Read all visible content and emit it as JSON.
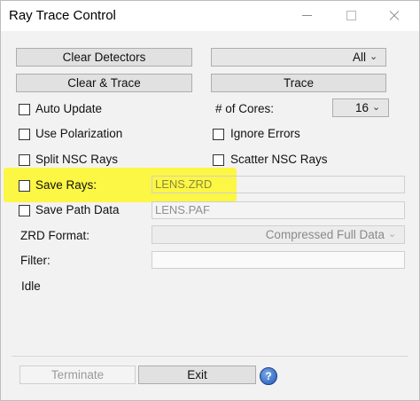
{
  "window": {
    "title": "Ray Trace Control"
  },
  "toolbar": {
    "clear_detectors": "Clear Detectors",
    "detector_select": "All",
    "clear_and_trace": "Clear & Trace",
    "trace": "Trace"
  },
  "options": {
    "auto_update": "Auto Update",
    "cores_label": "# of Cores:",
    "cores_value": "16",
    "use_polarization": "Use Polarization",
    "ignore_errors": "Ignore Errors",
    "split_nsc_rays": "Split NSC Rays",
    "scatter_nsc_rays": "Scatter NSC Rays",
    "save_rays": "Save Rays:",
    "save_rays_file": "LENS.ZRD",
    "save_path_data": "Save Path Data",
    "save_path_file": "LENS.PAF",
    "zrd_format_label": "ZRD Format:",
    "zrd_format_value": "Compressed Full Data",
    "filter_label": "Filter:",
    "filter_value": ""
  },
  "status": {
    "text": "Idle"
  },
  "footer": {
    "terminate": "Terminate",
    "exit": "Exit",
    "help": "?"
  },
  "colors": {
    "highlight": "#fff600",
    "help_blue": "#1f57b8"
  }
}
